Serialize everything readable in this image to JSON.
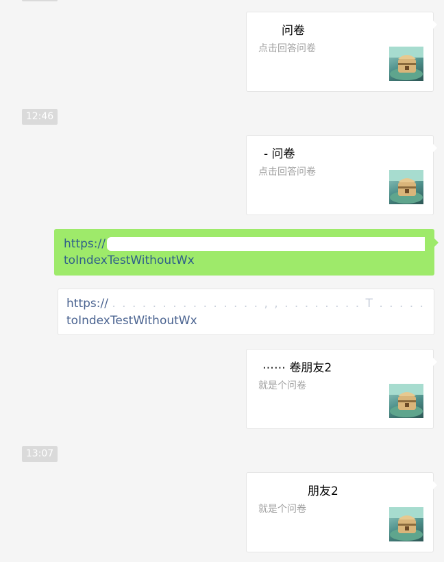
{
  "timestamps": [
    "12:46",
    "13:07"
  ],
  "cards": [
    {
      "title": "问卷",
      "desc": "点击回答问卷",
      "thumb_icon": "treasure-chest-icon"
    },
    {
      "title": "-   问卷",
      "desc": "点击回答问卷",
      "thumb_icon": "treasure-chest-icon"
    },
    {
      "title": "⋯⋯   卷朋友2",
      "desc": "就是个问卷",
      "thumb_icon": "treasure-chest-icon"
    },
    {
      "title": "朋友2",
      "desc": "就是个问卷",
      "thumb_icon": "treasure-chest-icon"
    }
  ],
  "sent_message": {
    "line1": "https://",
    "line2": "toIndexTestWithoutWx",
    "bubble_color": "#9eea6a"
  },
  "link_message": {
    "line1": "https://",
    "line1_faint": ". . . . . . . .  . . . . . . . , , . . . . . . . .  T . . . . . /",
    "line2": "toIndexTestWithoutWx",
    "link_color": "#4a6390"
  }
}
